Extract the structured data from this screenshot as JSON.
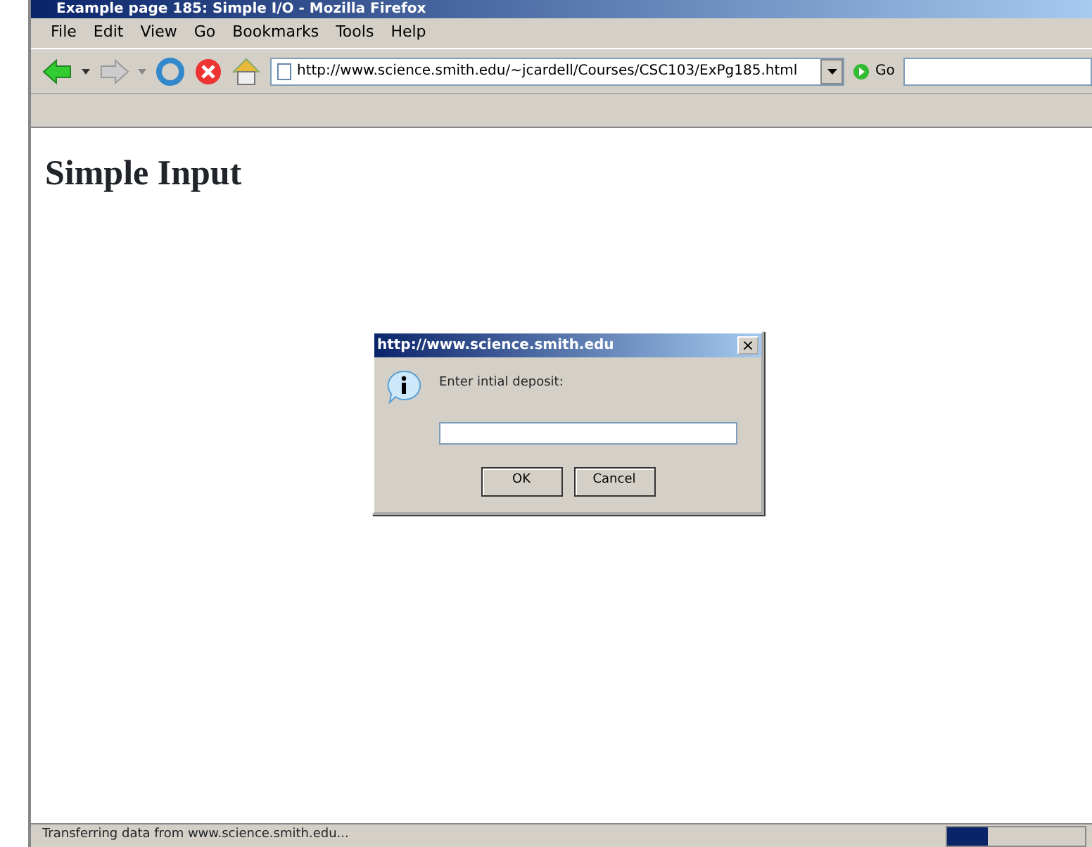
{
  "window": {
    "title": "Example page 185: Simple I/O - Mozilla Firefox"
  },
  "menu": [
    "File",
    "Edit",
    "View",
    "Go",
    "Bookmarks",
    "Tools",
    "Help"
  ],
  "toolbar": {
    "url": "http://www.science.smith.edu/~jcardell/Courses/CSC103/ExPg185.html",
    "go": "Go"
  },
  "page": {
    "heading": "Simple Input"
  },
  "dialog": {
    "title": "http://www.science.smith.edu",
    "close": "×",
    "message": "Enter intial deposit:",
    "buttons": [
      "OK",
      "Cancel"
    ]
  },
  "status_bar": {
    "text": "Transferring data from www.science.smith.edu...",
    "progress": {
      "level": 0.3
    }
  }
}
